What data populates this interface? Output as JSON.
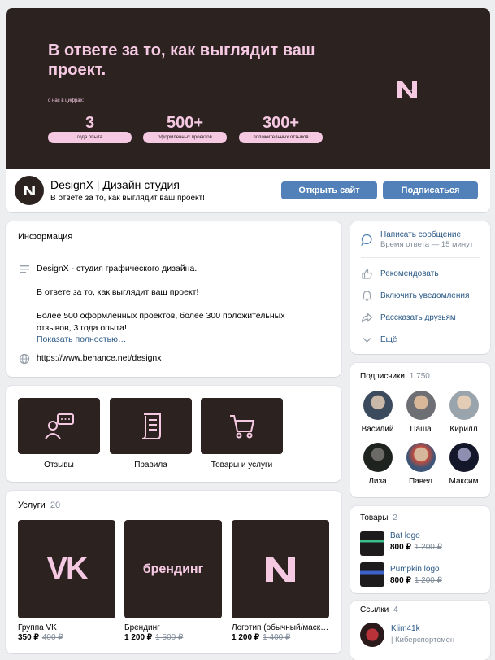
{
  "cover": {
    "title": "В ответе за то, как выглядит ваш проект.",
    "numbers_caption": "о нас в цифрах:",
    "stats": [
      {
        "value": "3",
        "label": "года опыта"
      },
      {
        "value": "500+",
        "label": "оформленных проектов"
      },
      {
        "value": "300+",
        "label": "положительных отзывов"
      }
    ]
  },
  "header": {
    "name": "DesignX | Дизайн студия",
    "status": "В ответе за то, как выглядит ваш проект!",
    "open_site_label": "Открыть сайт",
    "subscribe_label": "Подписаться"
  },
  "info": {
    "title": "Информация",
    "p1": "DesignX - студия графического дизайна.",
    "p2": "В ответе за то, как выглядит ваш проект!",
    "p3": "Более 500 оформленных проектов, более 300 положительных отзывов, 3 года опыта!",
    "show_more": "Показать полностью…",
    "website": "https://www.behance.net/designx"
  },
  "tiles": [
    {
      "label": "Отзывы",
      "icon": "review-chat-icon"
    },
    {
      "label": "Правила",
      "icon": "rules-document-icon"
    },
    {
      "label": "Товары и услуги",
      "icon": "shopping-cart-icon"
    }
  ],
  "services": {
    "title": "Услуги",
    "count": "20",
    "items": [
      {
        "name": "Группа VK",
        "price": "350 ₽",
        "old": "400 ₽",
        "image_text": "VK"
      },
      {
        "name": "Брендинг",
        "price": "1 200 ₽",
        "old": "1 500 ₽",
        "image_text": "брендинг"
      },
      {
        "name": "Логотип (обычный/маскот)",
        "price": "1 200 ₽",
        "old": "1 400 ₽",
        "image_text": ""
      }
    ]
  },
  "actions": {
    "message": "Написать сообщение",
    "response_time": "Время ответа — 15 минут",
    "recommend": "Рекомендовать",
    "notify": "Включить уведомления",
    "share": "Рассказать друзьям",
    "more": "Ещё"
  },
  "subscribers": {
    "title": "Подписчики",
    "count": "1 750",
    "people": [
      {
        "name": "Василий"
      },
      {
        "name": "Паша"
      },
      {
        "name": "Кирилл"
      },
      {
        "name": "Лиза"
      },
      {
        "name": "Павел"
      },
      {
        "name": "Максим"
      }
    ]
  },
  "products": {
    "title": "Товары",
    "count": "2",
    "items": [
      {
        "name": "Bat logo",
        "price": "800 ₽",
        "old": "1 200 ₽"
      },
      {
        "name": "Pumpkin logo",
        "price": "800 ₽",
        "old": "1 200 ₽"
      }
    ]
  },
  "links": {
    "title": "Ссылки",
    "count": "4",
    "items": [
      {
        "name": "Klim41k",
        "desc": "| Киберспортсмен"
      }
    ]
  },
  "colors": {
    "brand_dark": "#2c2321",
    "brand_pink": "#f6c9e3",
    "button": "#5181b8",
    "link": "#2a5885"
  }
}
